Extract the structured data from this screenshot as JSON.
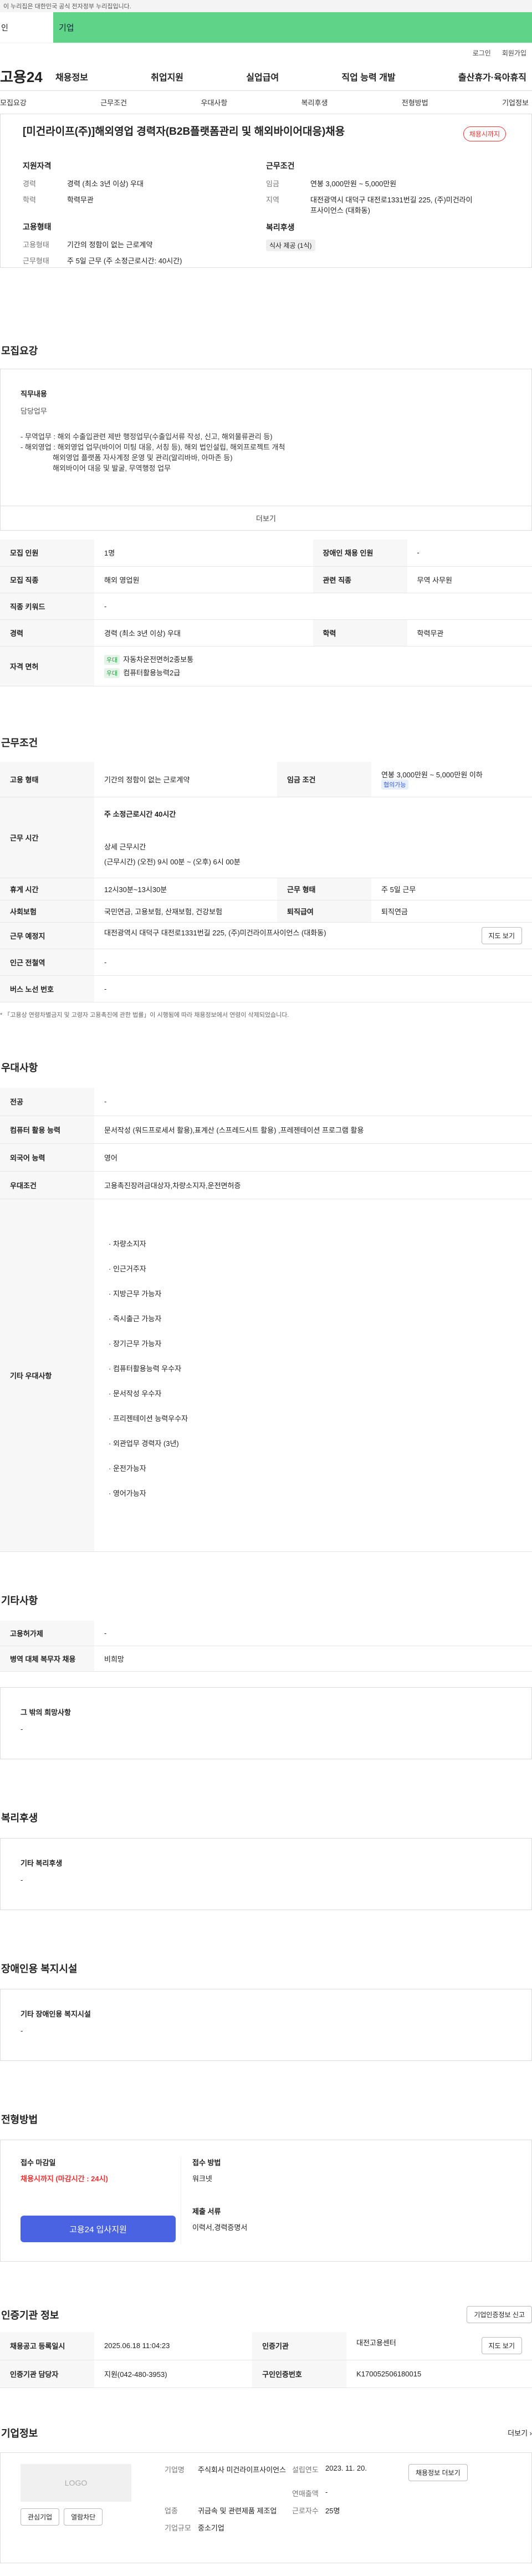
{
  "gov_banner": "이 누리집은 대한민국 공식 전자정부 누리집입니다.",
  "verify": {
    "left": "인",
    "bar": "기업"
  },
  "util": {
    "login": "로그인",
    "join": "회원가입"
  },
  "logo": "고용24",
  "gnb": [
    "채용정보",
    "취업지원",
    "실업급여",
    "직업 능력 개발",
    "출산휴가·육아휴직"
  ],
  "tabs": [
    "모집요강",
    "근무조건",
    "우대사항",
    "복리후생",
    "전형방법",
    "기업정보"
  ],
  "job": {
    "title": "[미건라이프(주)]해외영업 경력자(B2B플랫폼관리 및 해외바이어대응)채용",
    "badge": "채용시까지",
    "qual_h": "지원자격",
    "career_k": "경력",
    "career_v": "경력 (최소 3년 이상) 우대",
    "edu_k": "학력",
    "edu_v": "학력무관",
    "emp_h": "고용형태",
    "emp_k": "고용형태",
    "emp_v": "기간의 정함이 없는 근로계약",
    "hours_k": "근무형태",
    "hours_v": "주 5일 근무 (주 소정근로시간: 40시간)",
    "cond_h": "근무조건",
    "wage_k": "임금",
    "wage_v": "연봉 3,000만원 ~ 5,000만원",
    "loc_k": "지역",
    "loc_v": "대전광역시 대덕구 대전로1331번길 225, (주)미건라이프사이언스 (대화동)",
    "welfare_h": "복리후생",
    "welfare_tag": "식사 제공 (1식)"
  },
  "recruit": {
    "title": "모집요강",
    "duty_h": "직무내용",
    "duty_sub": "담당업무",
    "duty_lines": [
      "- 무역업무 : 해외 수출입관련 제반 행정업무(수출입서류 작성, 신고, 해외물류관리 등)",
      "- 해외영업 : 해외영업 업무(바이어 미팅 대응, 서칭 등), 해외 법인설립, 해외프로젝트 개척",
      "해외영업 플랫폼 자사계정 운영 및 관리(알리바바, 아마존 등)",
      "해외바이어 대응 및 발굴, 무역행정 업무"
    ],
    "more": "더보기",
    "rows": [
      {
        "k1": "모집 인원",
        "v1": "1명",
        "k2": "장애인 채용 인원",
        "v2": "-"
      },
      {
        "k1": "모집 직종",
        "v1": "해외 영업원",
        "k2": "관련 직종",
        "v2": "무역 사무원"
      },
      {
        "k1": "직종 키워드",
        "v1": "-"
      },
      {
        "k1": "경력",
        "v1": "경력 (최소 3년 이상) 우대",
        "k2": "학력",
        "v2": "학력무관"
      }
    ],
    "license_k": "자격 면허",
    "lic": [
      {
        "chip": "우대",
        "name": "자동차운전면허2종보통"
      },
      {
        "chip": "우대",
        "name": "컴퓨터활용능력2급"
      }
    ]
  },
  "work": {
    "title": "근무조건",
    "emp_k": "고용 형태",
    "emp_v": "기간의 정함이 없는 근로계약",
    "wage_k": "임금 조건",
    "wage_v": "연봉 3,000만원 ~ 5,000만원 이하",
    "wage_chip": "협의가능",
    "time_k": "근무 시간",
    "time_main": "주 소정근로시간 40시간",
    "time_sub": "상세 근무시간",
    "time_detail": "(근무시간) (오전) 9시 00분 ~ (오후) 6시 00분",
    "rest_k": "휴게 시간",
    "rest_v": "12시30분~13시30분",
    "type_k": "근무 형태",
    "type_v": "주 5일 근무",
    "ins_k": "사회보험",
    "ins_v": "국민연금, 고용보험, 산재보험, 건강보험",
    "ret_k": "퇴직급여",
    "ret_v": "퇴직연금",
    "addr_k": "근무 예정지",
    "addr_v": "대전광역시 대덕구 대전로1331번길 225, (주)미건라이프사이언스 (대화동)",
    "map_btn": "지도 보기",
    "sub_k": "인근 전철역",
    "sub_v": "-",
    "bus_k": "버스 노선 번호",
    "bus_v": "-",
    "note": "* 「고용상 연령차별금지 및 고령자 고용촉진에 관한 법률」이 시행됨에 따라 채용정보에서 연령이 삭제되었습니다."
  },
  "pref": {
    "title": "우대사항",
    "major_k": "전공",
    "major_v": "-",
    "pc_k": "컴퓨터 활용 능력",
    "pc_v": "문서작성 (워드프로세서 활용),표계산 (스프레드시트 활용) ,프레젠테이션 프로그램 활용",
    "lang_k": "외국어 능력",
    "lang_v": "영어",
    "cond_k": "우대조건",
    "cond_v": "고용촉진장려금대상자,차량소지자,운전면허증",
    "etc_k": "기타 우대사항",
    "etc_list": [
      "차량소지자",
      "인근거주자",
      "지방근무 가능자",
      "즉시출근 가능자",
      "장기근무 가능자",
      "컴퓨터활용능력 우수자",
      "문서작성 우수자",
      "프리젠테이션 능력우수자",
      "외관업무 경력자 (3년)",
      "운전가능자",
      "영어가능자"
    ]
  },
  "other": {
    "title": "기타사항",
    "k1": "고용허가제",
    "v1": "-",
    "k2": "병역 대체 복무자 채용",
    "v2": "비희망",
    "hope_h": "그 밖의 희망사항",
    "hope_v": "-"
  },
  "welfare": {
    "title": "복리후생",
    "h": "기타 복리후생",
    "v": "-"
  },
  "disab": {
    "title": "장애인용 복지시설",
    "h": "기타 장애인용 복지시설",
    "v": "-"
  },
  "process": {
    "title": "전형방법",
    "deadline_h": "접수 마감일",
    "deadline_v": "채용시까지 (마감시간 : 24시)",
    "method_h": "접수 방법",
    "method_v": "워크넷",
    "docs_h": "제출 서류",
    "docs_v": "이력서,경력증명서",
    "apply_btn": "고용24 입사지원"
  },
  "auth": {
    "title": "인증기관 정보",
    "fav_btn": "기업인증정보 신고",
    "date_k": "채용공고 등록일시",
    "date_v": "2025.06.18 11:04:23",
    "org_k": "인증기관",
    "org_v": "대전고용센터",
    "map_btn": "지도 보기",
    "mgr_k": "인증기관 담당자",
    "mgr_v": "지원(042-480-3953)",
    "no_k": "구인인증번호",
    "no_v": "K170052506180015"
  },
  "company": {
    "title": "기업정보",
    "more": "더보기 ›",
    "logo": "LOGO",
    "fav": "관심기업",
    "block": "열람차단",
    "name_k": "기업명",
    "name_v": "주식회사 미건라이프사이언스",
    "est_k": "설립연도",
    "est_v": "2023. 11. 20.",
    "rev_k": "연매출액",
    "rev_v": "-",
    "ind_k": "업종",
    "ind_v": "귀금속 및 관련제품 제조업",
    "emp_k": "근로자수",
    "emp_v": "25명",
    "size_k": "기업규모",
    "size_v": "중소기업",
    "info_btn": "채용정보 더보기"
  }
}
